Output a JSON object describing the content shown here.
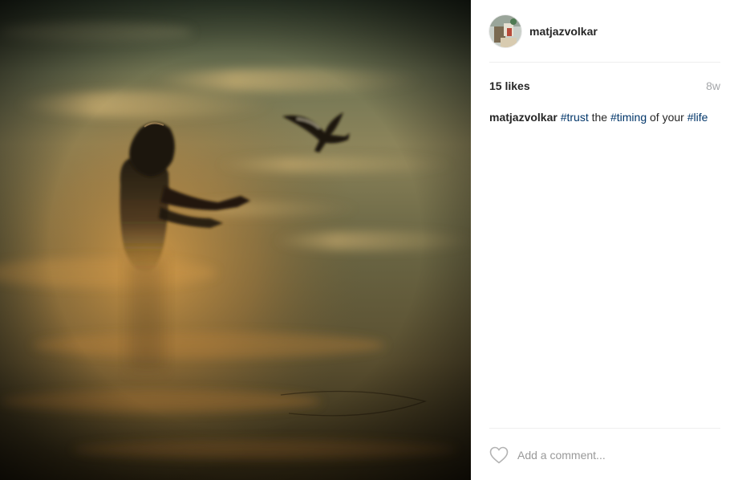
{
  "post": {
    "username": "matjazvolkar",
    "likes": "15 likes",
    "time_ago": "8w",
    "caption": {
      "user": "matjazvolkar",
      "parts": [
        {
          "text": "#trust",
          "hashtag": true
        },
        {
          "text": " the ",
          "hashtag": false
        },
        {
          "text": "#timing",
          "hashtag": true
        },
        {
          "text": " of your ",
          "hashtag": false
        },
        {
          "text": "#life",
          "hashtag": true
        }
      ]
    },
    "comment_placeholder": "Add a comment..."
  },
  "icons": {
    "like": "heart-outline-icon",
    "avatar": "profile-avatar"
  },
  "colors": {
    "hashtag": "#003569",
    "text": "#262626",
    "muted": "#a5a7aa",
    "divider": "#efefef"
  }
}
